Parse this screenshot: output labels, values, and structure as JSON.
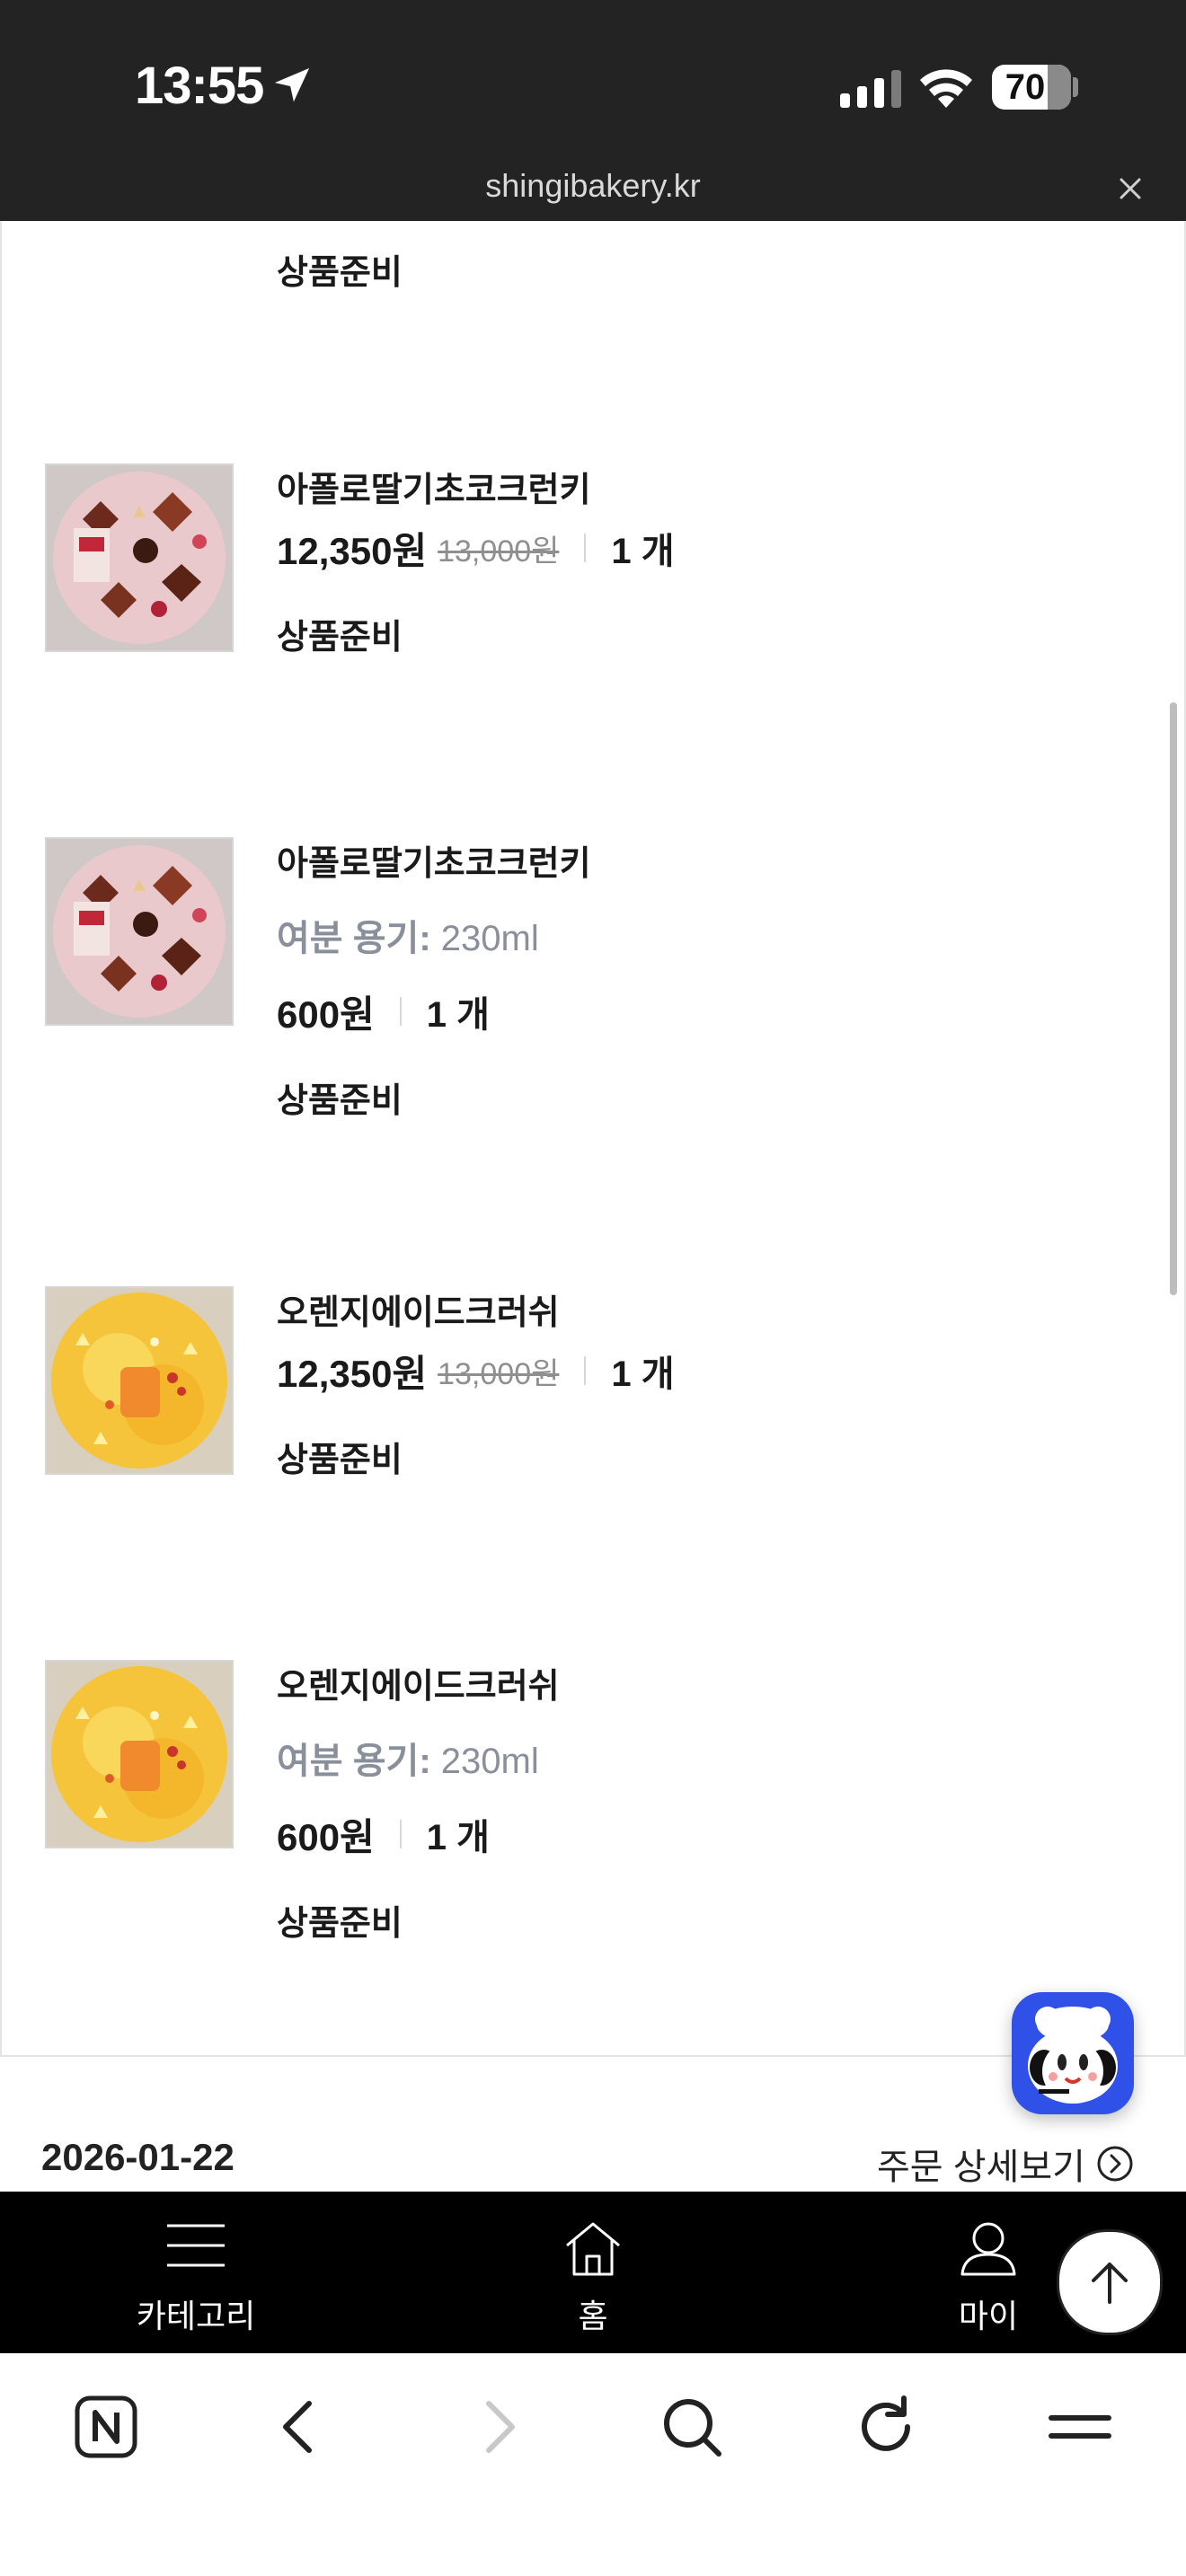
{
  "status_bar": {
    "time": "13:55",
    "battery": "70",
    "battery_level": 0.7
  },
  "browser": {
    "domain": "shingibakery.kr"
  },
  "items": [
    {
      "name": "",
      "option_label": "",
      "option_value": "",
      "price": "",
      "original_price": "",
      "quantity": "",
      "status": "상품준비"
    },
    {
      "name": "아폴로딸기초코크런키",
      "option_label": "",
      "option_value": "",
      "price": "12,350원",
      "original_price": "13,000원",
      "quantity": "1 개",
      "status": "상품준비"
    },
    {
      "name": "아폴로딸기초코크런키",
      "option_label": "여분 용기:",
      "option_value": "230ml",
      "price": "600원",
      "original_price": "",
      "quantity": "1 개",
      "status": "상품준비"
    },
    {
      "name": "오렌지에이드크러쉬",
      "option_label": "",
      "option_value": "",
      "price": "12,350원",
      "original_price": "13,000원",
      "quantity": "1 개",
      "status": "상품준비"
    },
    {
      "name": "오렌지에이드크러쉬",
      "option_label": "여분 용기:",
      "option_value": "230ml",
      "price": "600원",
      "original_price": "",
      "quantity": "1 개",
      "status": "상품준비"
    }
  ],
  "next_order": {
    "date": "2026-01-22",
    "detail_link": "주문 상세보기"
  },
  "app_nav": {
    "category": "카테고리",
    "home": "홈",
    "my": "마이"
  },
  "colors": {
    "status_bar_bg": "#232323",
    "chatbot_bg": "#2f51e8",
    "nav_bg": "#000000"
  }
}
